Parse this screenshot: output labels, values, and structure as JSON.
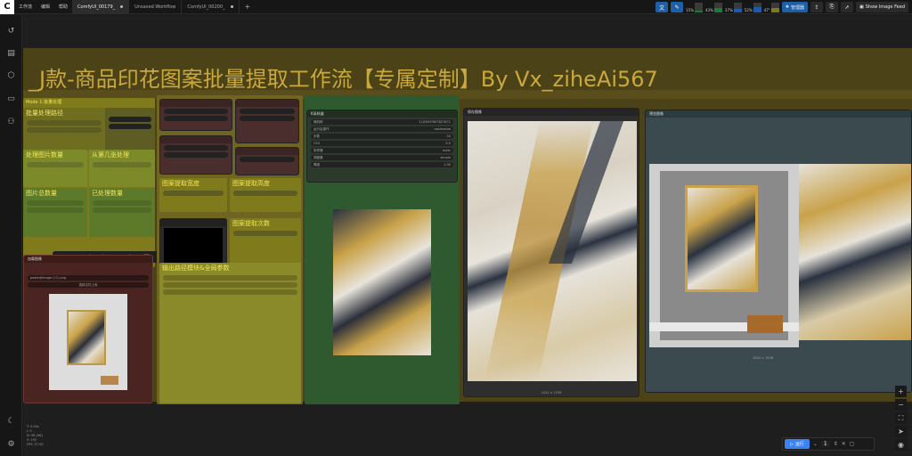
{
  "topbar": {
    "logo": "C",
    "menu": [
      "工作流",
      "编辑",
      "帮助"
    ],
    "tabs": [
      {
        "label": "ComfyUI_00179_",
        "active": true
      },
      {
        "label": "Unsaved Workflow",
        "active": false
      },
      {
        "label": "ComfyUI_00200_",
        "active": false
      }
    ],
    "plus": "+",
    "stats": [
      {
        "name": "CPU",
        "pct": "15%",
        "level": 0.15,
        "color": "#1e7a3a"
      },
      {
        "name": "RAM",
        "pct": "43%",
        "level": 0.43,
        "color": "#1e7a3a"
      },
      {
        "name": "GPU",
        "pct": "37%",
        "level": 0.37,
        "color": "#1e5aa8"
      },
      {
        "name": "VRAM",
        "pct": "52%",
        "level": 0.52,
        "color": "#1e5aa8"
      },
      {
        "name": "Temp",
        "pct": "47°",
        "level": 0.47,
        "color": "#7a7a1e"
      }
    ],
    "manager_label": "管理器",
    "feed_label": "Show Image Feed"
  },
  "sidebar_icons": [
    "history-icon",
    "queue-icon",
    "node-library-icon",
    "workflows-icon",
    "model-library-icon",
    "theme-icon",
    "settings-icon"
  ],
  "canvas": {
    "title": "_J款-商品印花图案批量提取工作流【专属定制】By Vx_ziheAi567",
    "left_group": {
      "header": "Mode 1:批量处理",
      "sections": [
        "批量处理路径",
        "处理图片数量",
        "从第几张处理",
        "图片总数量",
        "已处理数量"
      ]
    },
    "middle_group": {
      "sections": [
        "图案提取宽度",
        "图案提取高度",
        "图案提取次数",
        "输出路径模块&全局参数"
      ]
    },
    "load_image": {
      "title": "加载图像",
      "filename": "pasted/image (11).png",
      "upload": "选择文件上传"
    },
    "sampler": {
      "title": "K采样器",
      "rows": [
        {
          "k": "随机种",
          "v": "1103907857827671"
        },
        {
          "k": "运行后操作",
          "v": "randomize"
        },
        {
          "k": "步数",
          "v": "20"
        },
        {
          "k": "CFG",
          "v": "5.0"
        },
        {
          "k": "采样器",
          "v": "euler"
        },
        {
          "k": "调度器",
          "v": "simple"
        },
        {
          "k": "降噪",
          "v": "1.00"
        }
      ]
    },
    "preview_a": "保存图像",
    "preview_b": "预览图像",
    "preview_c": "预览图像",
    "caption_a": "1024 × 1536",
    "caption_b": "1024 × 1536",
    "caption_c": "1024 × 1024",
    "float_bar": [
      "▷",
      "■",
      "⟋",
      "⇞",
      "⧉",
      "✎",
      "🗑",
      "ⓘ"
    ]
  },
  "footer": {
    "stats_text": "T: 0.00s\nI: 0\nN: 96 [96]\nV: 192\nFPS: 57.00",
    "run_label": "运行",
    "run_count": "1"
  }
}
